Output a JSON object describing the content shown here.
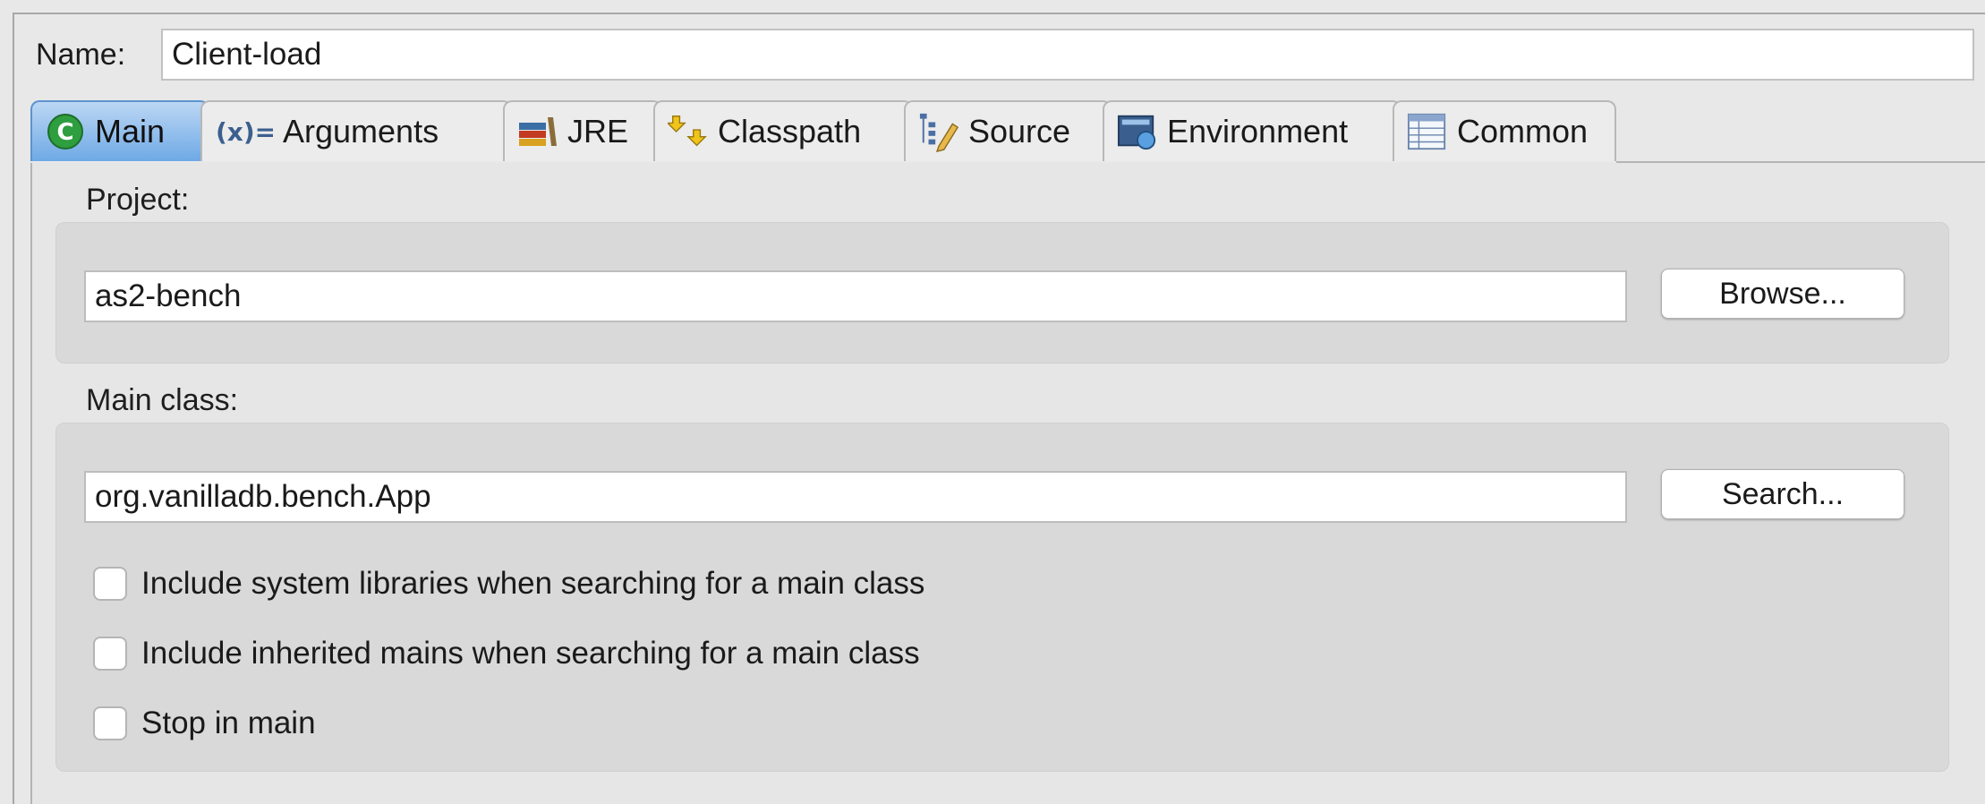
{
  "name": {
    "label": "Name:",
    "value": "Client-load"
  },
  "tabs": [
    {
      "label": "Main",
      "icon": "main-c-icon",
      "active": true
    },
    {
      "label": "Arguments",
      "icon": "arguments-x-icon",
      "active": false
    },
    {
      "label": "JRE",
      "icon": "jre-books-icon",
      "active": false
    },
    {
      "label": "Classpath",
      "icon": "classpath-icon",
      "active": false
    },
    {
      "label": "Source",
      "icon": "source-tree-icon",
      "active": false
    },
    {
      "label": "Environment",
      "icon": "environment-icon",
      "active": false
    },
    {
      "label": "Common",
      "icon": "common-table-icon",
      "active": false
    }
  ],
  "project": {
    "label": "Project:",
    "value": "as2-bench",
    "browse_label": "Browse..."
  },
  "main_class": {
    "label": "Main class:",
    "value": "org.vanilladb.bench.App",
    "search_label": "Search...",
    "options": [
      {
        "label": "Include system libraries when searching for a main class",
        "checked": false
      },
      {
        "label": "Include inherited mains when searching for a main class",
        "checked": false
      },
      {
        "label": "Stop in main",
        "checked": false
      }
    ]
  },
  "colors": {
    "active_tab": "#6ea9e6",
    "main_icon": "#2e9e3e",
    "panel": "#e6e6e6",
    "group": "#d9d9d9"
  }
}
